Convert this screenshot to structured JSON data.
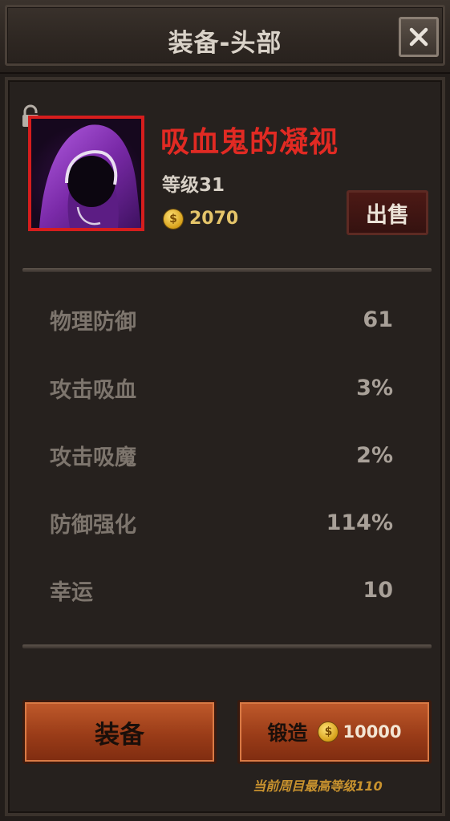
{
  "header": {
    "title": "装备-头部"
  },
  "item": {
    "name": "吸血鬼的凝视",
    "level": "等级31",
    "price": "2070",
    "coin_symbol": "$",
    "sell_label": "出售"
  },
  "stats": [
    {
      "label": "物理防御",
      "value": "61"
    },
    {
      "label": "攻击吸血",
      "value": "3%"
    },
    {
      "label": "攻击吸魔",
      "value": "2%"
    },
    {
      "label": "防御强化",
      "value": "114%"
    },
    {
      "label": "幸运",
      "value": "10"
    }
  ],
  "actions": {
    "equip_label": "装备",
    "forge_label": "锻造",
    "forge_cost": "10000"
  },
  "footnote": "当前周目最高等级110",
  "colors": {
    "item_name": "#e12a23",
    "portrait_border": "#d61d1d",
    "button_orange": "#b24c22",
    "gold": "#e5c56a"
  },
  "icons": [
    "close-icon",
    "lock-icon",
    "hood-portrait",
    "coin-icon"
  ]
}
